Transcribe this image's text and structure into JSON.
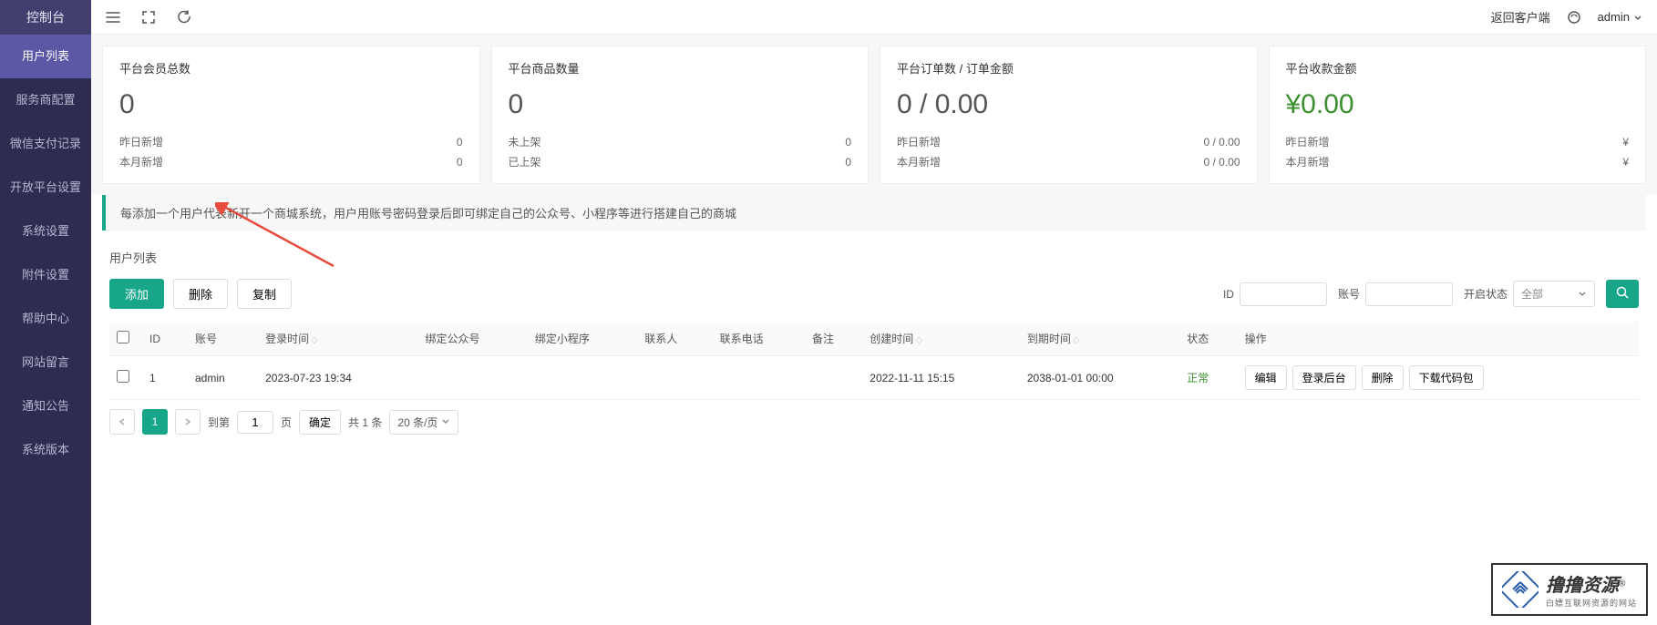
{
  "sidebar": {
    "title": "控制台",
    "items": [
      {
        "label": "用户列表",
        "active": true
      },
      {
        "label": "服务商配置"
      },
      {
        "label": "微信支付记录"
      },
      {
        "label": "开放平台设置"
      },
      {
        "label": "系统设置"
      },
      {
        "label": "附件设置"
      },
      {
        "label": "帮助中心"
      },
      {
        "label": "网站留言"
      },
      {
        "label": "通知公告"
      },
      {
        "label": "系统版本"
      }
    ]
  },
  "topbar": {
    "back_client": "返回客户端",
    "user": "admin"
  },
  "stats": [
    {
      "title": "平台会员总数",
      "value": "0",
      "rows": [
        {
          "label": "昨日新增",
          "value": "0"
        },
        {
          "label": "本月新增",
          "value": "0"
        }
      ]
    },
    {
      "title": "平台商品数量",
      "value": "0",
      "rows": [
        {
          "label": "未上架",
          "value": "0"
        },
        {
          "label": "已上架",
          "value": "0"
        }
      ]
    },
    {
      "title": "平台订单数 / 订单金额",
      "value": "0 / 0.00",
      "rows": [
        {
          "label": "昨日新增",
          "value": "0 / 0.00"
        },
        {
          "label": "本月新增",
          "value": "0 / 0.00"
        }
      ]
    },
    {
      "title": "平台收款金额",
      "value": "¥0.00",
      "green": true,
      "rows": [
        {
          "label": "昨日新增",
          "value": "¥"
        },
        {
          "label": "本月新增",
          "value": "¥"
        }
      ]
    }
  ],
  "notice": "每添加一个用户代表新开一个商城系统，用户用账号密码登录后即可绑定自己的公众号、小程序等进行搭建自己的商城",
  "section": {
    "title": "用户列表"
  },
  "toolbar": {
    "add": "添加",
    "delete": "删除",
    "copy": "复制",
    "filters": {
      "id_label": "ID",
      "account_label": "账号",
      "status_label": "开启状态",
      "status_value": "全部"
    }
  },
  "table": {
    "headers": {
      "id": "ID",
      "account": "账号",
      "login_time": "登录时间",
      "bind_gzh": "绑定公众号",
      "bind_xcx": "绑定小程序",
      "contact": "联系人",
      "phone": "联系电话",
      "remark": "备注",
      "create_time": "创建时间",
      "expire_time": "到期时间",
      "status": "状态",
      "actions": "操作"
    },
    "rows": [
      {
        "id": "1",
        "account": "admin",
        "login_time": "2023-07-23 19:34",
        "bind_gzh": "",
        "bind_xcx": "",
        "contact": "",
        "phone": "",
        "remark": "",
        "create_time": "2022-11-11 15:15",
        "expire_time": "2038-01-01 00:00",
        "status": "正常"
      }
    ],
    "row_actions": {
      "edit": "编辑",
      "login_backend": "登录后台",
      "delete": "删除",
      "download_pkg": "下载代码包"
    }
  },
  "pagination": {
    "goto_label": "到第",
    "page_value": "1",
    "page_label": "页",
    "confirm": "确定",
    "total": "共 1 条",
    "per_page": "20 条/页"
  },
  "watermark": {
    "main": "撸撸资源",
    "sub": "白嫖互联网资源的网站"
  }
}
